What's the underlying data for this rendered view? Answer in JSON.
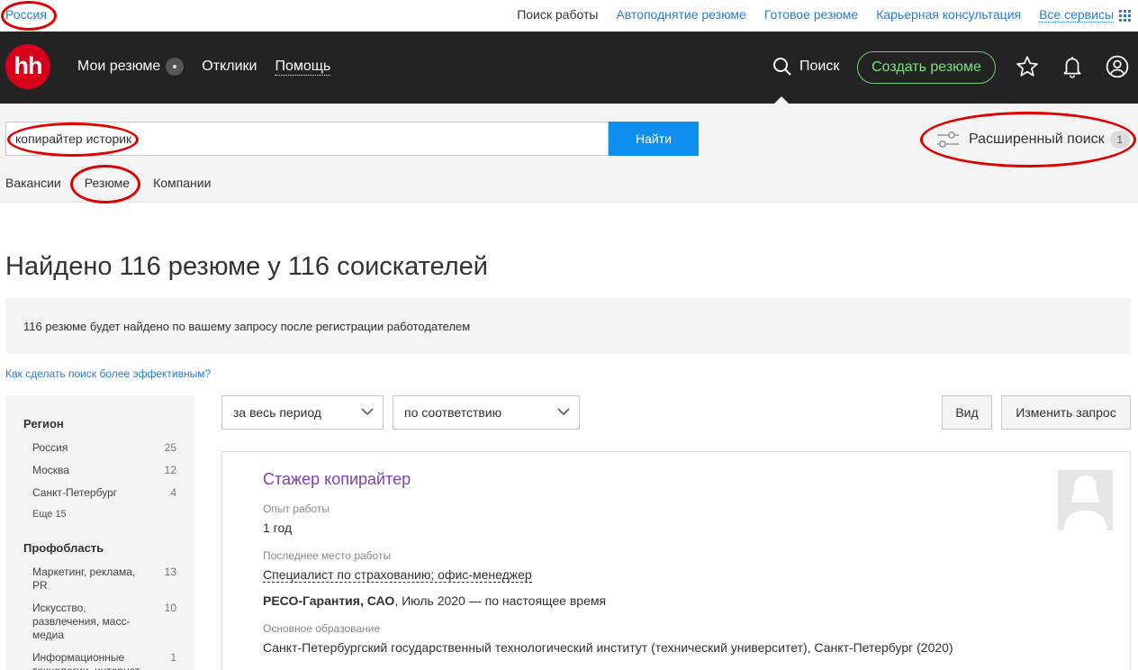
{
  "topbar": {
    "region": "Россия",
    "links": [
      "Поиск работы",
      "Автоподнятие резюме",
      "Готовое резюме",
      "Карьерная консультация"
    ],
    "all_services": "Все сервисы"
  },
  "header": {
    "logo": "hh",
    "nav": {
      "my_resumes": "Мои резюме",
      "responses": "Отклики",
      "help": "Помощь"
    },
    "search": "Поиск",
    "create_resume": "Создать резюме"
  },
  "search": {
    "query": "копирайтер историк",
    "button": "Найти",
    "advanced": "Расширенный поиск",
    "advanced_count": "1",
    "tabs": [
      "Вакансии",
      "Резюме",
      "Компании"
    ]
  },
  "results": {
    "title": "Найдено 116 резюме у 116 соискателей",
    "notice": "116 резюме будет найдено по вашему запросу после регистрации работодателем",
    "tips_link": "Как сделать поиск более эффективным?"
  },
  "sidebar": {
    "region_heading": "Регион",
    "regions": [
      {
        "label": "Россия",
        "count": "25"
      },
      {
        "label": "Москва",
        "count": "12"
      },
      {
        "label": "Санкт-Петербург",
        "count": "4"
      }
    ],
    "region_more": "Еще 15",
    "prof_heading": "Профобласть",
    "profs": [
      {
        "label": "Маркетинг, реклама, PR",
        "count": "13"
      },
      {
        "label": "Искусство, развлечения, масс-медиа",
        "count": "10"
      },
      {
        "label": "Информационные технологии, интернет",
        "count": "1"
      }
    ]
  },
  "filters": {
    "period": "за весь период",
    "sort": "по соответствию",
    "view": "Вид",
    "change_query": "Изменить запрос"
  },
  "card": {
    "title": "Стажер копирайтер",
    "experience_label": "Опыт работы",
    "experience": "1 год",
    "last_job_label": "Последнее место работы",
    "last_job": "Специалист по страхованию; офис-менеджер",
    "company": "РЕСО-Гарантия, САО",
    "period": ", Июль 2020 — по настоящее время",
    "education_label": "Основное образование",
    "education": "Санкт-Петербургский государственный технологический институт (технический университет), Санкт-Петербург (2020)"
  },
  "colors": {
    "header_bg": "#232323",
    "logo_red": "#d6001c",
    "link_blue": "#2b7bd0",
    "button_blue": "#0f8fee",
    "create_green": "#7fe07f",
    "title_purple": "#7a42b5",
    "annotation_red": "#e10000"
  }
}
